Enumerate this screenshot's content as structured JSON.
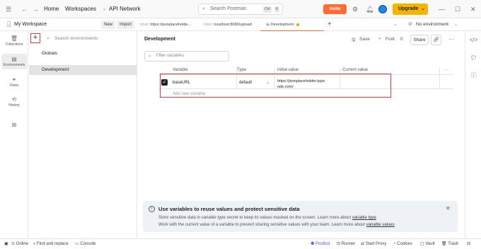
{
  "topbar": {
    "home": "Home",
    "workspaces": "Workspaces",
    "api_network": "API Network",
    "search_placeholder": "Search Postman",
    "kbd_ctrl": "Ctrl",
    "kbd_k": "K",
    "invite": "Invite",
    "upgrade": "Upgrade"
  },
  "subheader": {
    "workspace": "My Workspace",
    "new": "New",
    "import": "Import",
    "tabs": [
      {
        "method": "POST",
        "label": "https://jsonplaceholde..."
      },
      {
        "method": "POST",
        "label": "localhost:8080/upload"
      },
      {
        "method": "",
        "label": "Development"
      }
    ],
    "env_select": "No environment"
  },
  "rail": {
    "collections": "Collections",
    "environments": "Environments",
    "flows": "Flows",
    "history": "History"
  },
  "env_panel": {
    "search_placeholder": "Search environments",
    "items": [
      "Globals",
      "Development"
    ]
  },
  "main": {
    "title": "Development",
    "save": "Save",
    "fork": "Fork",
    "fork_count": "0",
    "share": "Share",
    "filter_placeholder": "Filter variables",
    "columns": [
      "Variable",
      "Type",
      "Initial value",
      "Current value"
    ],
    "row": {
      "variable": "baseURL",
      "type": "default",
      "initial_value_line1": "https://jsonplaceholder.typic",
      "initial_value_line2": "ode.com/",
      "current_value": ""
    },
    "add_new": "Add new variable"
  },
  "banner": {
    "heading": "Use variables to reuse values and protect sensitive data",
    "line1_pre": "Store sensitive data in variable type secret to keep its values masked on the screen. Learn more about ",
    "line1_link": "variable type",
    "line2_pre": "Work with the current value of a variable to prevent sharing sensitive values with your team. Learn more about ",
    "line2_link": "variable values"
  },
  "statusbar": {
    "online": "Online",
    "find_replace": "Find and replace",
    "console": "Console",
    "postbot": "Postbot",
    "runner": "Runner",
    "start_proxy": "Start Proxy",
    "cookies": "Cookies",
    "vault": "Vault",
    "trash": "Trash"
  },
  "colors": {
    "accent": "#ff6c37",
    "upgrade": "#f4b400",
    "highlight_border": "#e53935"
  }
}
